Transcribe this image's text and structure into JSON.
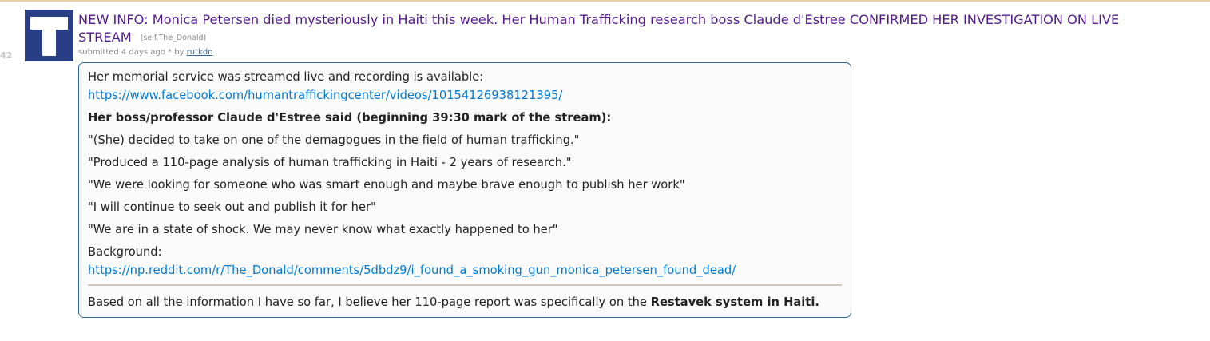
{
  "post": {
    "score": "42",
    "thumbnail_letter": "T",
    "title": "NEW INFO: Monica Petersen died mysteriously in Haiti this week. Her Human Trafficking research boss Claude d'Estree CONFIRMED HER INVESTIGATION ON LIVE STREAM",
    "domain": "(self.The_Donald)",
    "tagline": {
      "submitted": "submitted 4 days ago",
      "edited_marker": "*",
      "by": "by",
      "author": "rutkdn"
    }
  },
  "selftext": {
    "memorial_line": "Her memorial service was streamed live and recording is available:",
    "facebook_link": "https://www.facebook.com/humantraffickingcenter/videos/10154126938121395/",
    "boss_heading": "Her boss/professor Claude d'Estree said (beginning 39:30 mark of the stream):",
    "quotes": [
      "\"(She) decided to take on one of the demagogues in the field of human trafficking.\"",
      "\"Produced a 110-page analysis of human trafficking in Haiti - 2 years of research.\"",
      "\"We were looking for someone who was smart enough and maybe brave enough to publish her work\"",
      "\"I will continue to seek out and publish it for her\"",
      "\"We are in a state of shock. We may never know what exactly happened to her\""
    ],
    "background_label": "Background:",
    "background_link": "https://np.reddit.com/r/The_Donald/comments/5dbdz9/i_found_a_smoking_gun_monica_petersen_found_dead/",
    "conclusion_prefix": "Based on all the information I have so far, I believe her 110-page report was specifically on the ",
    "conclusion_bold": "Restavek system in Haiti."
  },
  "colors": {
    "thumbnail_bg": "#2a3e86",
    "title_visited": "#551a8b",
    "link": "#0079d3",
    "selftext_border": "#336699"
  }
}
